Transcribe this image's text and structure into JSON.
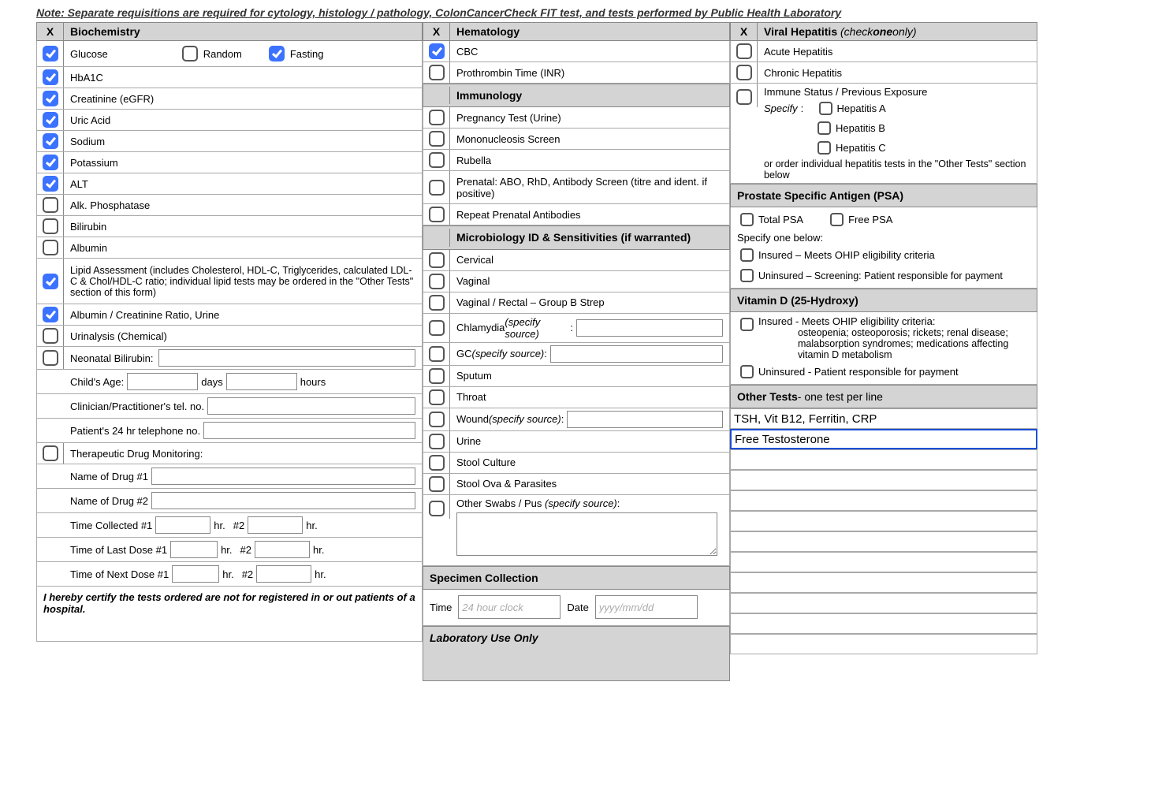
{
  "note": "Note: Separate requisitions are required for cytology, histology / pathology, ColonCancerCheck FIT test, and tests performed by Public Health Laboratory",
  "x": "X",
  "biochem": {
    "title": "Biochemistry",
    "glucose": "Glucose",
    "random": "Random",
    "fasting": "Fasting",
    "hba1c": "HbA1C",
    "creatinine": "Creatinine (eGFR)",
    "uric": "Uric Acid",
    "sodium": "Sodium",
    "potassium": "Potassium",
    "alt": "ALT",
    "alkphos": "Alk. Phosphatase",
    "bilirubin": "Bilirubin",
    "albumin": "Albumin",
    "lipid": "Lipid Assessment (includes Cholesterol, HDL-C, Triglycerides, calculated LDL-C & Chol/HDL-C ratio; individual lipid tests may be ordered in the \"Other Tests\" section of this form)",
    "acr": "Albumin / Creatinine Ratio, Urine",
    "urinalysis": "Urinalysis (Chemical)",
    "neobili": "Neonatal Bilirubin:",
    "childage": "Child's Age:",
    "days": "days",
    "hours": "hours",
    "cliniciantel": "Clinician/Practitioner's tel. no.",
    "patienttel": "Patient's 24 hr telephone no.",
    "tdm": "Therapeutic Drug Monitoring:",
    "drug1": "Name of Drug #1",
    "drug2": "Name of Drug #2",
    "timecoll": "Time Collected #1",
    "hr": "hr.",
    "num2": "#2",
    "lastdose": "Time of Last Dose #1",
    "nextdose": "Time of Next Dose #1"
  },
  "hema": {
    "title": "Hematology",
    "cbc": "CBC",
    "pt": "Prothrombin Time (INR)"
  },
  "immuno": {
    "title": "Immunology",
    "preg": "Pregnancy Test (Urine)",
    "mono": "Mononucleosis Screen",
    "rubella": "Rubella",
    "prenatal": "Prenatal: ABO, RhD, Antibody Screen (titre and ident. if positive)",
    "repeat": "Repeat Prenatal Antibodies"
  },
  "micro": {
    "title": "Microbiology ID & Sensitivities (if warranted)",
    "cervical": "Cervical",
    "vaginal": "Vaginal",
    "vrgbs": "Vaginal / Rectal – Group B Strep",
    "chlamydia": "Chlamydia ",
    "chlamydia_src": "(specify source)",
    "colon": ":",
    "gc": "GC ",
    "gc_src": "(specify source)",
    "sputum": "Sputum",
    "throat": "Throat",
    "wound": "Wound ",
    "wound_src": "(specify source)",
    "urine": "Urine",
    "stoolcult": "Stool Culture",
    "stoolova": "Stool Ova & Parasites",
    "otherswabs": "Other Swabs / Pus ",
    "otherswabs_src": "(specify source)"
  },
  "specimen": {
    "title": "Specimen Collection",
    "time": "Time",
    "time_ph": "24 hour clock",
    "date": "Date",
    "date_ph": "yyyy/mm/dd"
  },
  "labuse": "Laboratory Use Only",
  "vhep": {
    "title_pre": "Viral Hepatitis ",
    "title_suf": "(check ",
    "one": "one",
    "only": " only)",
    "acute": "Acute Hepatitis",
    "chronic": "Chronic Hepatitis",
    "immune": "Immune Status / Previous Exposure",
    "specify": "Specify",
    "colon": ":",
    "hepa": "Hepatitis A",
    "hepb": "Hepatitis B",
    "hepc": "Hepatitis C",
    "note": "or order individual hepatitis tests in the \"Other Tests\" section below"
  },
  "psa": {
    "title": "Prostate Specific Antigen (PSA)",
    "total": "Total PSA",
    "free": "Free PSA",
    "specify": "Specify one below:",
    "insured": "Insured – Meets OHIP eligibility criteria",
    "uninsured": "Uninsured – Screening: Patient responsible for payment"
  },
  "vitd": {
    "title": "Vitamin D (25-Hydroxy)",
    "insured": "Insured - Meets OHIP eligibility criteria:",
    "criteria": "osteopenia; osteoporosis; rickets; renal disease; malabsorption syndromes; medications affecting vitamin D metabolism",
    "uninsured": "Uninsured - Patient responsible for payment"
  },
  "other": {
    "title_pre": "Other Tests",
    "title_suf": " - one test per line",
    "line1": "TSH, Vit B12, Ferritin, CRP",
    "line2": "Free Testosterone"
  },
  "certify": "I hereby certify the tests ordered are not for registered in or out patients of a hospital."
}
